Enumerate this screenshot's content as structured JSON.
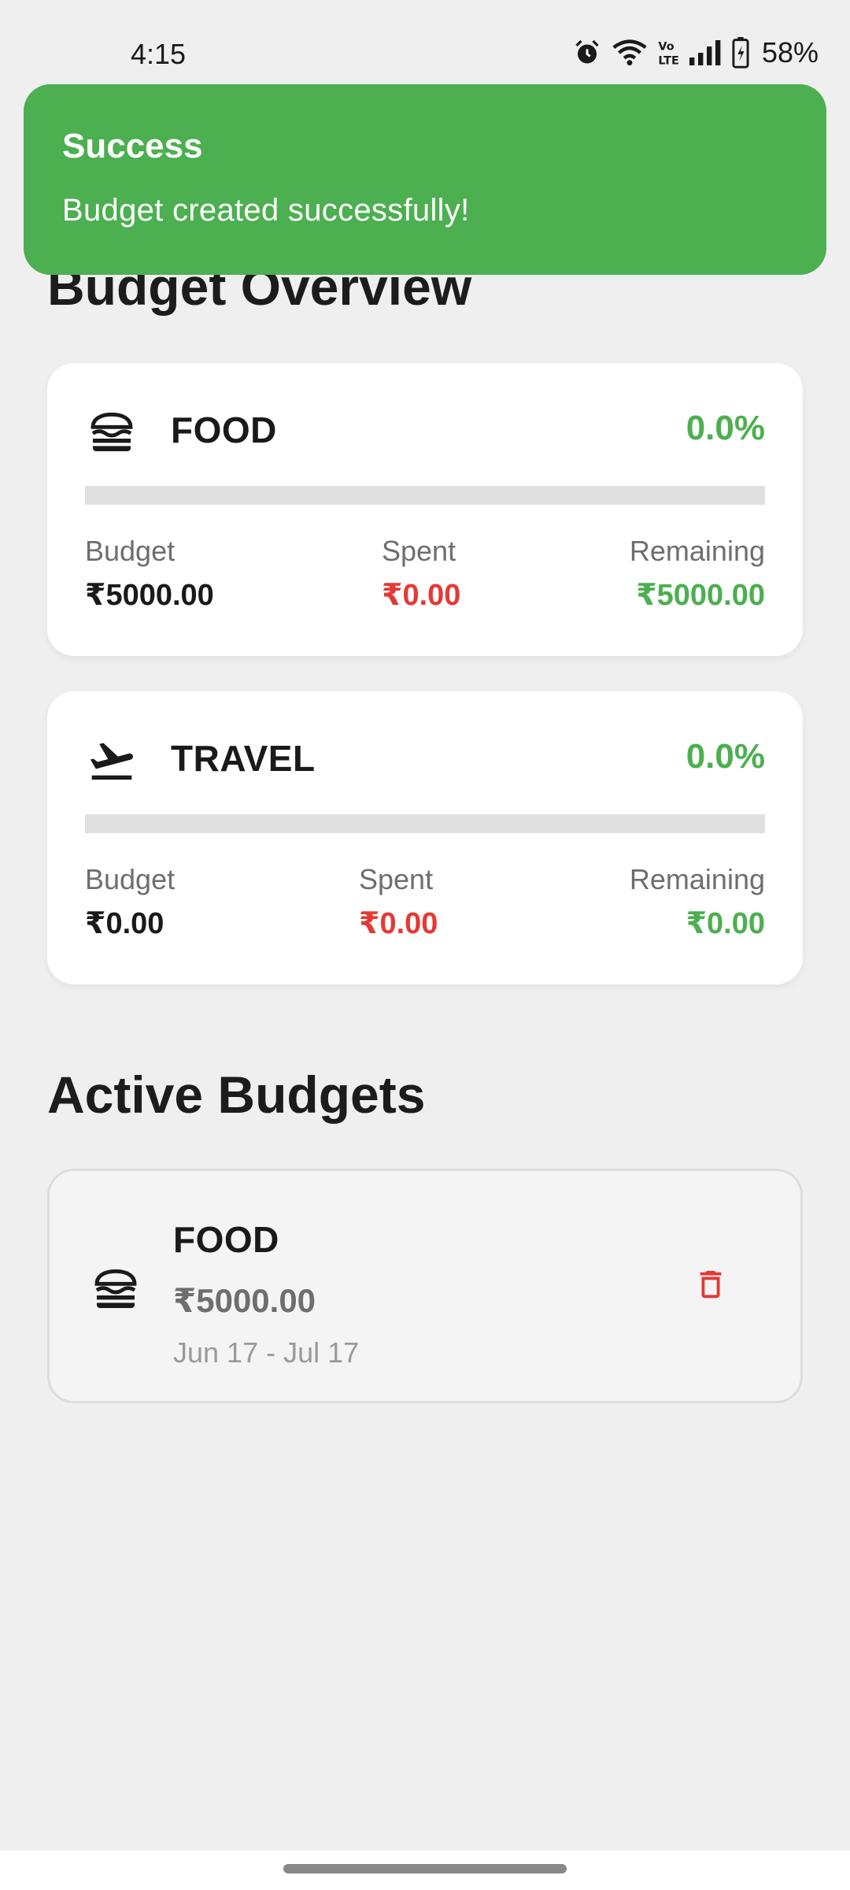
{
  "status_bar": {
    "time": "4:15",
    "battery": "58%",
    "icons": [
      "alarm-icon",
      "wifi-icon",
      "volte-icon",
      "signal-icon",
      "battery-icon"
    ]
  },
  "snackbar": {
    "title": "Success",
    "message": "Budget created successfully!",
    "color": "#4caf50"
  },
  "overview": {
    "title": "Budget Overview",
    "cards": [
      {
        "icon": "burger-icon",
        "category": "FOOD",
        "percent": "0.0%",
        "progress_fraction": 0.0,
        "budget_label": "Budget",
        "budget_value": "₹5000.00",
        "spent_label": "Spent",
        "spent_value": "₹0.00",
        "remaining_label": "Remaining",
        "remaining_value": "₹5000.00"
      },
      {
        "icon": "flight-takeoff-icon",
        "category": "TRAVEL",
        "percent": "0.0%",
        "progress_fraction": 0.0,
        "budget_label": "Budget",
        "budget_value": "₹0.00",
        "spent_label": "Spent",
        "spent_value": "₹0.00",
        "remaining_label": "Remaining",
        "remaining_value": "₹0.00"
      }
    ]
  },
  "active_budgets": {
    "title": "Active Budgets",
    "items": [
      {
        "icon": "burger-icon",
        "category": "FOOD",
        "amount": "₹5000.00",
        "dates": "Jun 17 - Jul 17"
      }
    ]
  },
  "colors": {
    "accent_green": "#4caf50",
    "danger_red": "#e53935",
    "background": "#efefef"
  }
}
